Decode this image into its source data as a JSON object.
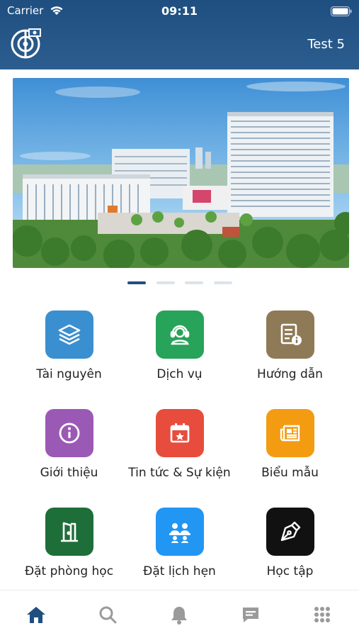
{
  "status_bar": {
    "carrier": "Carrier",
    "time": "09:11"
  },
  "header": {
    "user_name": "Test 5"
  },
  "carousel": {
    "page_count": 4,
    "active_index": 0
  },
  "menu": [
    {
      "label": "Tài nguyên",
      "icon": "layers-icon",
      "color": "#3a8fd0"
    },
    {
      "label": "Dịch vụ",
      "icon": "support-agent-icon",
      "color": "#27a35a"
    },
    {
      "label": "Hướng dẫn",
      "icon": "document-info-icon",
      "color": "#8f7a57"
    },
    {
      "label": "Giới thiệu",
      "icon": "info-icon",
      "color": "#9b59b6"
    },
    {
      "label": "Tin tức & Sự kiện",
      "icon": "calendar-star-icon",
      "color": "#e74c3c"
    },
    {
      "label": "Biểu mẫu",
      "icon": "newspaper-icon",
      "color": "#f39c12"
    },
    {
      "label": "Đặt phòng học",
      "icon": "door-icon",
      "color": "#1e6e3a"
    },
    {
      "label": "Đặt lịch hẹn",
      "icon": "meeting-icon",
      "color": "#2196f3"
    },
    {
      "label": "Học tập",
      "icon": "pen-nib-icon",
      "color": "#111111"
    }
  ],
  "tabbar": {
    "active_color": "#1f4f80",
    "inactive_color": "#9a9a9a",
    "tabs": [
      {
        "icon": "home-icon",
        "active": true
      },
      {
        "icon": "search-icon",
        "active": false
      },
      {
        "icon": "bell-icon",
        "active": false
      },
      {
        "icon": "chat-icon",
        "active": false
      },
      {
        "icon": "apps-grid-icon",
        "active": false
      }
    ]
  }
}
